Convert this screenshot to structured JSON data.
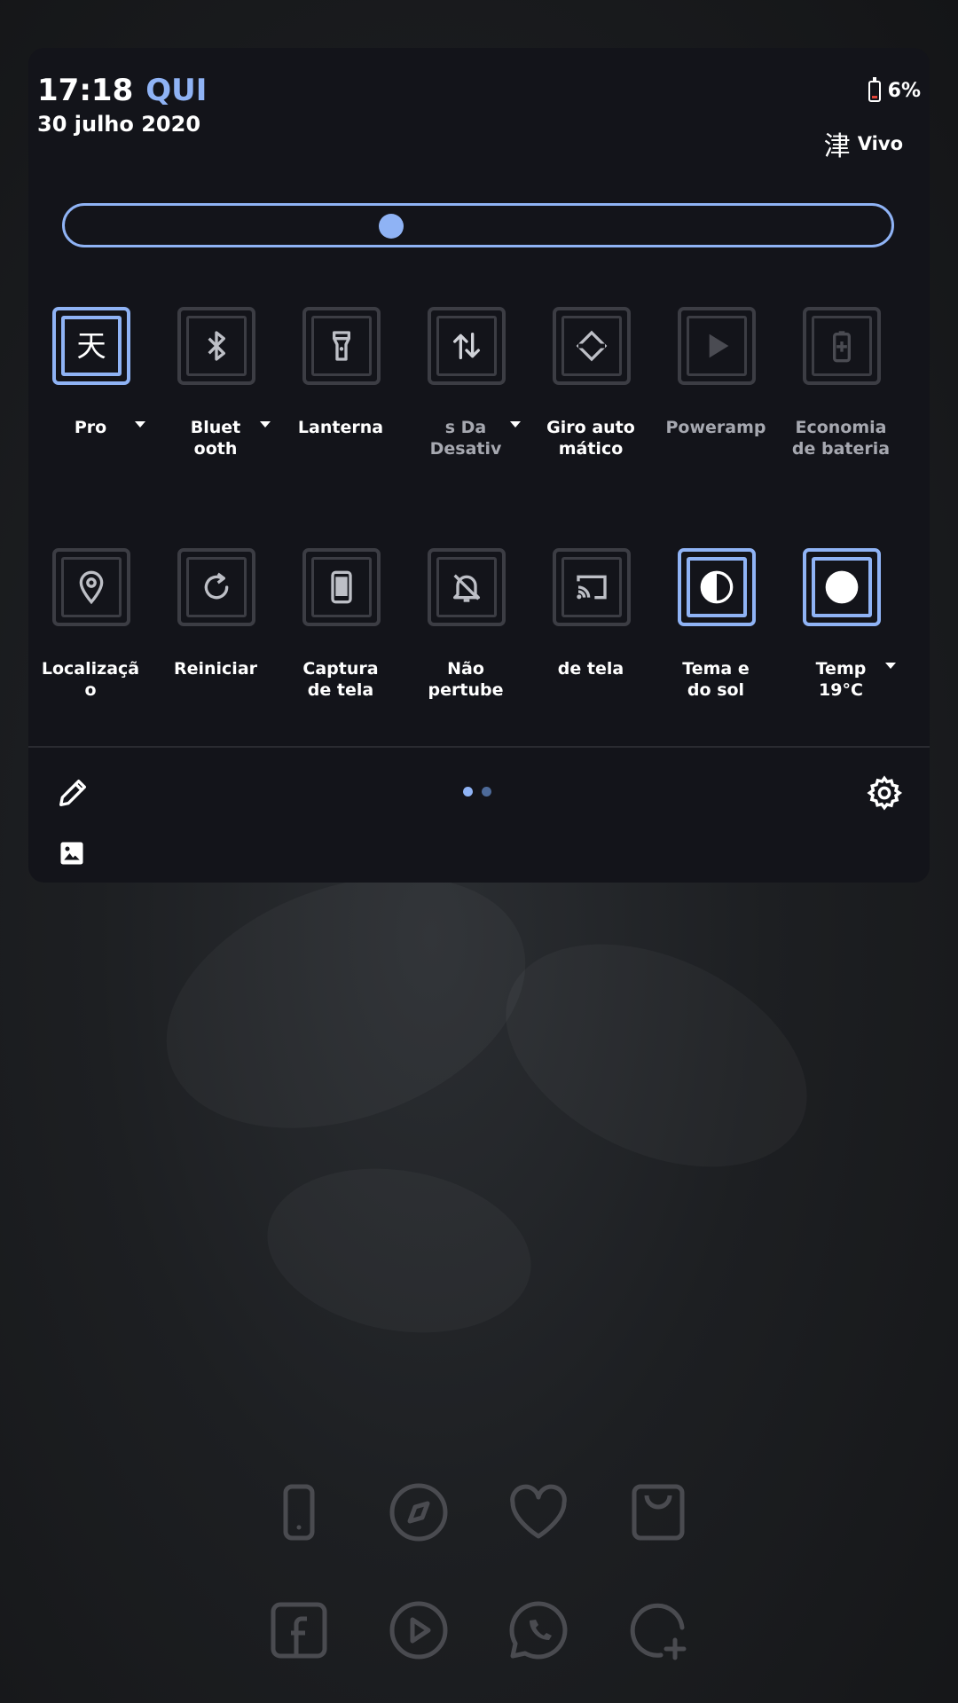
{
  "status": {
    "time": "17:18",
    "day": "QUI",
    "date": "30 julho 2020",
    "battery_percent": "6%",
    "carrier_glyph": "津",
    "carrier_name": "Vivo"
  },
  "brightness": {
    "level": 0.395
  },
  "tiles_row1": [
    {
      "label": "Pro",
      "active": true,
      "icon": "kanji-tian-icon",
      "caret": true
    },
    {
      "label": "Bluet\nooth",
      "active": false,
      "icon": "bluetooth-icon",
      "caret": true
    },
    {
      "label": "Lanterna",
      "active": false,
      "icon": "flashlight-icon",
      "caret": false
    },
    {
      "label": "s  Da\nDesativ",
      "active": false,
      "icon": "data-transfer-icon",
      "caret": true,
      "dim": true
    },
    {
      "label": "Giro auto\nmático",
      "active": false,
      "icon": "auto-rotate-icon",
      "caret": false
    },
    {
      "label": "Poweramp",
      "active": false,
      "icon": "play-icon",
      "caret": false,
      "dim": true
    },
    {
      "label": "Economia\nde bateria",
      "active": false,
      "icon": "battery-saver-icon",
      "caret": false,
      "dim": true
    }
  ],
  "tiles_row2": [
    {
      "label": "Localizaçã\no",
      "active": false,
      "icon": "location-pin-icon",
      "caret": false
    },
    {
      "label": "Reiniciar",
      "active": false,
      "icon": "restart-icon",
      "caret": false
    },
    {
      "label": "Captura\nde tela",
      "active": false,
      "icon": "phone-screenshot-icon",
      "caret": false
    },
    {
      "label": "Não\npertube",
      "active": false,
      "icon": "do-not-disturb-bell-icon",
      "caret": false
    },
    {
      "label": "de tela",
      "active": false,
      "icon": "cast-screen-icon",
      "caret": false
    },
    {
      "label": "Tema e\ndo sol",
      "active": true,
      "icon": "half-circle-theme-icon",
      "caret": false
    },
    {
      "label": "Temp\n19°C",
      "active": true,
      "icon": "full-circle-icon",
      "caret": true
    }
  ],
  "footer": {
    "pages": 2,
    "current_page": 1
  },
  "colors": {
    "accent": "#8fb3f5",
    "panel": "#13141a",
    "tile_border": "#3c3d44"
  },
  "dock": [
    {
      "icon": "phone-icon"
    },
    {
      "icon": "compass-icon"
    },
    {
      "icon": "heart-icon"
    },
    {
      "icon": "shopping-bag-icon"
    },
    {
      "icon": "facebook-icon"
    },
    {
      "icon": "play-circle-icon"
    },
    {
      "icon": "whatsapp-icon"
    },
    {
      "icon": "add-chat-icon"
    }
  ]
}
